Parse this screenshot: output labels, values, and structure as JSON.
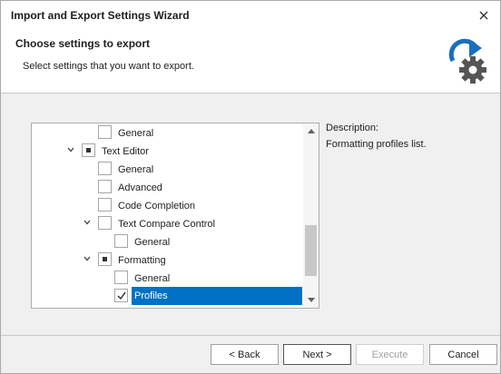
{
  "window": {
    "title": "Import and Export Settings Wizard"
  },
  "header": {
    "title": "Choose settings to export",
    "subtitle": "Select settings that you want to export.",
    "icon": "export-settings-gear-icon"
  },
  "tree": {
    "items": [
      {
        "label": "General",
        "level": 2,
        "expander": "none",
        "check": "unchecked",
        "selected": false
      },
      {
        "label": "Text Editor",
        "level": 1,
        "expander": "expanded",
        "check": "indeterminate",
        "selected": false
      },
      {
        "label": "General",
        "level": 2,
        "expander": "none",
        "check": "unchecked",
        "selected": false
      },
      {
        "label": "Advanced",
        "level": 2,
        "expander": "none",
        "check": "unchecked",
        "selected": false
      },
      {
        "label": "Code Completion",
        "level": 2,
        "expander": "none",
        "check": "unchecked",
        "selected": false
      },
      {
        "label": "Text Compare Control",
        "level": 2,
        "expander": "expanded",
        "check": "unchecked",
        "selected": false
      },
      {
        "label": "General",
        "level": 3,
        "expander": "none",
        "check": "unchecked",
        "selected": false
      },
      {
        "label": "Formatting",
        "level": 2,
        "expander": "expanded",
        "check": "indeterminate",
        "selected": false
      },
      {
        "label": "General",
        "level": 3,
        "expander": "none",
        "check": "unchecked",
        "selected": false
      },
      {
        "label": "Profiles",
        "level": 3,
        "expander": "none",
        "check": "checked",
        "selected": true
      }
    ],
    "scroll_position": 0.9
  },
  "description": {
    "label": "Description:",
    "text": "Formatting profiles list."
  },
  "buttons": {
    "back": "< Back",
    "next": "Next >",
    "execute": "Execute",
    "cancel": "Cancel"
  },
  "colors": {
    "selection": "#0071c5",
    "icon_blue": "#1a6fbf",
    "icon_gray": "#555555"
  }
}
